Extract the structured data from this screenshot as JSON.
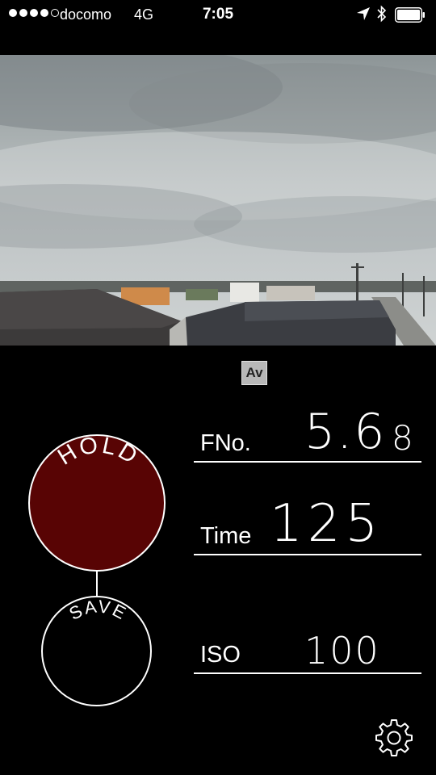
{
  "status_bar": {
    "carrier": "docomo",
    "network": "4G",
    "time": "7:05",
    "signal_bars_filled": 4,
    "signal_bars_total": 5
  },
  "camera": {
    "mode": "Av",
    "hold_label": "HOLD",
    "save_label": "SAVE"
  },
  "readouts": {
    "fno_label": "FNo.",
    "fno_value": "5.6",
    "fno_alt_value": "8",
    "time_label": "Time",
    "time_value": "125",
    "iso_label": "ISO",
    "iso_value": "100"
  },
  "colors": {
    "hold_fill": "#580404",
    "background": "#000000",
    "foreground": "#ffffff"
  },
  "icons": [
    "location-arrow-icon",
    "bluetooth-icon",
    "battery-icon",
    "gear-icon"
  ]
}
